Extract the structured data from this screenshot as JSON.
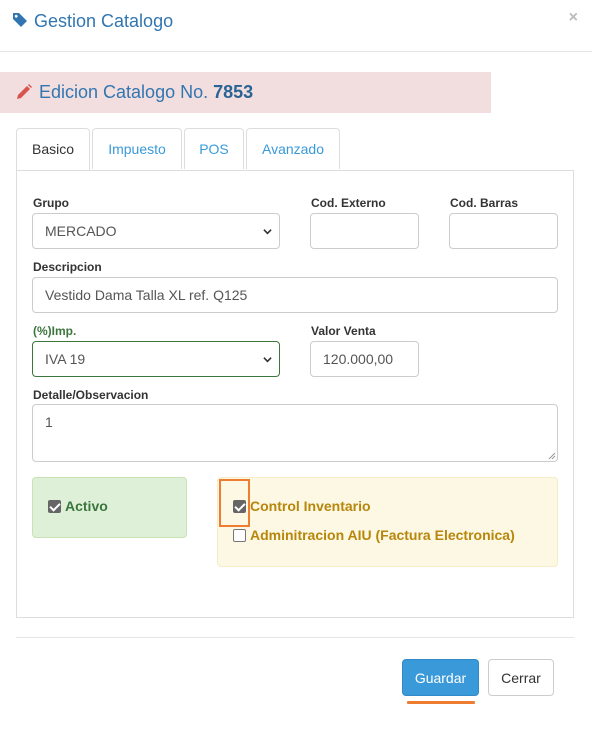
{
  "dialog": {
    "title": "Gestion Catalogo",
    "close_symbol": "×"
  },
  "banner": {
    "prefix": "Edicion Catalogo No.",
    "number": "7853"
  },
  "tabs": [
    {
      "label": "Basico",
      "active": true
    },
    {
      "label": "Impuesto",
      "active": false
    },
    {
      "label": "POS",
      "active": false
    },
    {
      "label": "Avanzado",
      "active": false
    }
  ],
  "form": {
    "grupo": {
      "label": "Grupo",
      "value": "MERCADO"
    },
    "cod_externo": {
      "label": "Cod. Externo",
      "value": ""
    },
    "cod_barras": {
      "label": "Cod. Barras",
      "value": ""
    },
    "descripcion": {
      "label": "Descripcion",
      "value": "Vestido Dama Talla XL ref. Q125"
    },
    "impuesto": {
      "label": "(%)Imp.",
      "value": "IVA 19"
    },
    "valor_venta": {
      "label": "Valor Venta",
      "value": "120.000,00"
    },
    "detalle": {
      "label": "Detalle/Observacion",
      "value": "1"
    }
  },
  "checks": {
    "activo": {
      "label": "Activo",
      "checked": true
    },
    "control_inventario": {
      "label": "Control Inventario",
      "checked": true
    },
    "aiu": {
      "label": "Adminitracion AIU (Factura Electronica)",
      "checked": false
    }
  },
  "buttons": {
    "save": "Guardar",
    "close": "Cerrar"
  },
  "colors": {
    "accent": "#3a9ad9",
    "title": "#3276b1",
    "banner_bg": "#f2dede",
    "highlight": "#ee7d31",
    "success_bg": "#dff0d8",
    "warning_bg": "#fcf8e3",
    "warning_text": "#b8860b",
    "success_text": "#3c763d"
  }
}
